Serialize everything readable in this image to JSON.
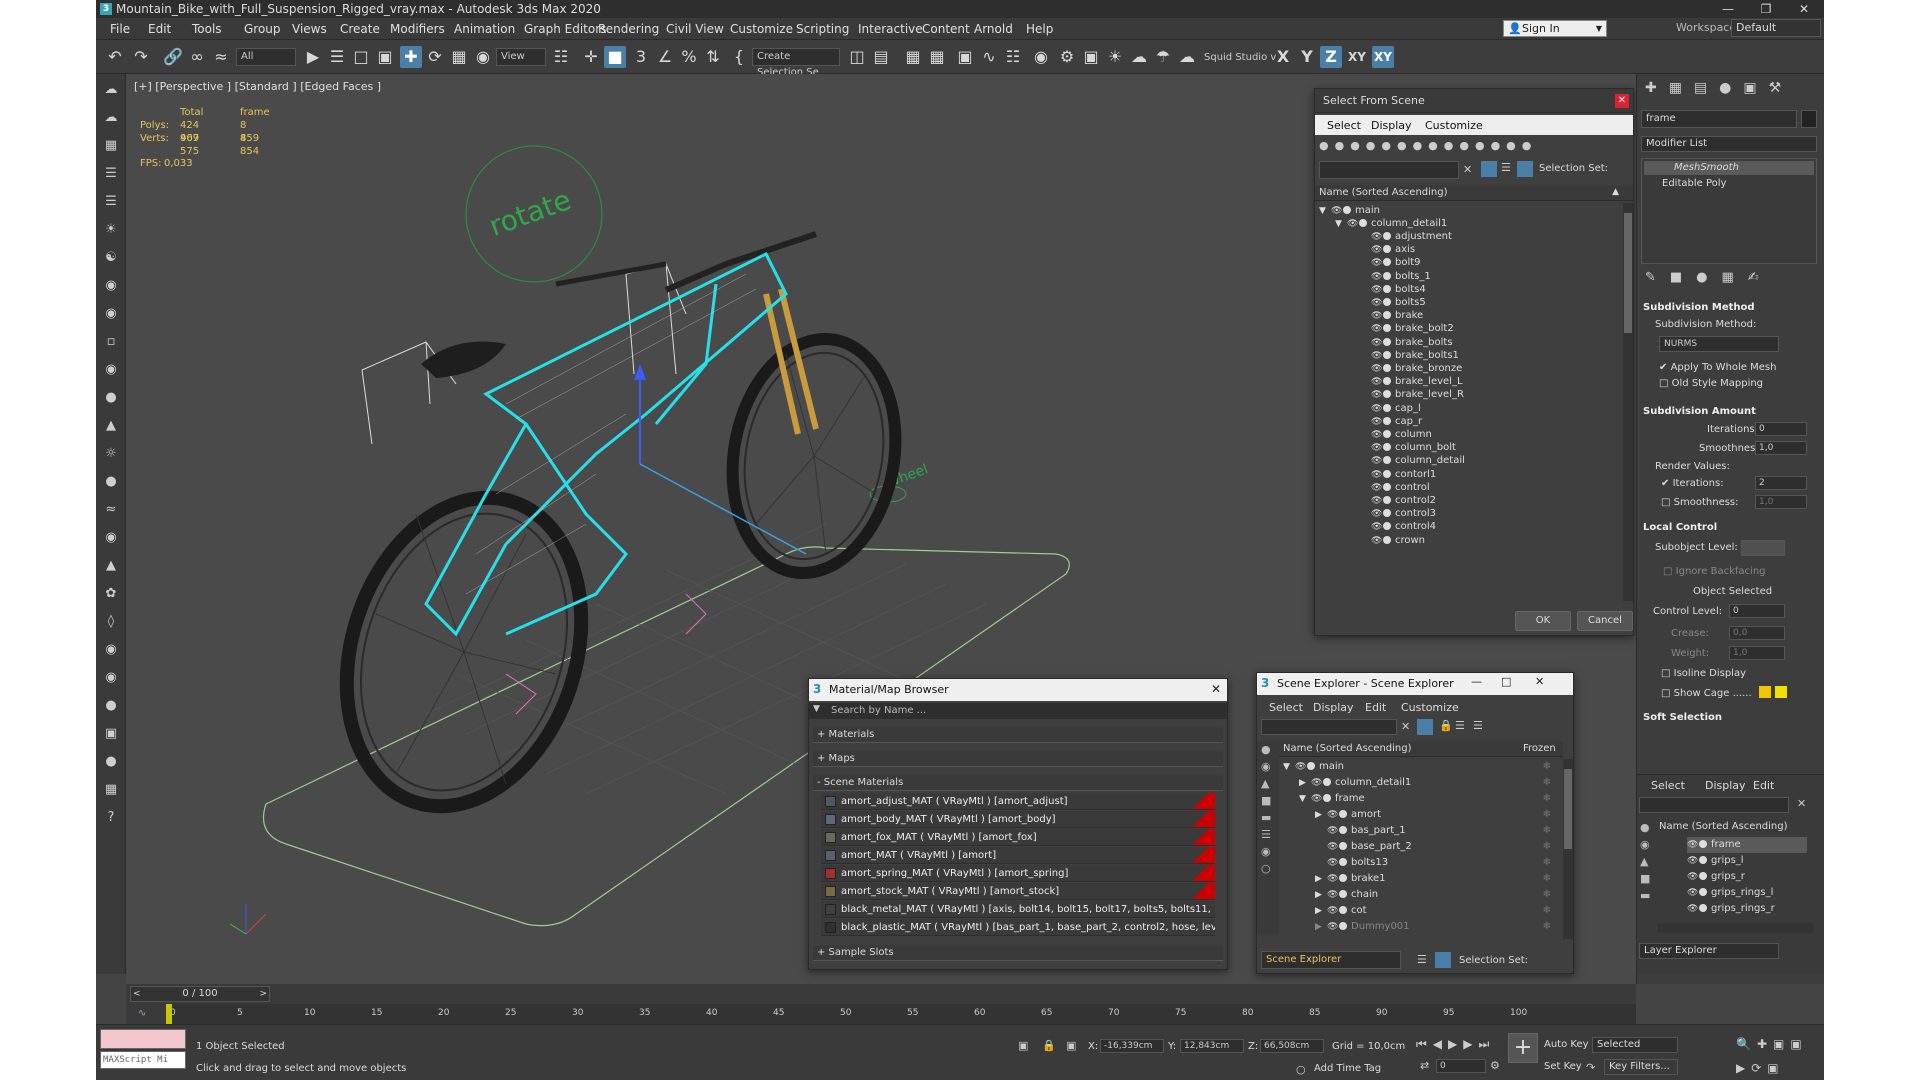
{
  "title": "Mountain_Bike_with_Full_Suspension_Rigged_vray.max - Autodesk 3ds Max 2020",
  "menu": [
    "File",
    "Edit",
    "Tools",
    "Group",
    "Views",
    "Create",
    "Modifiers",
    "Animation",
    "Graph Editors",
    "Rendering",
    "Civil View",
    "Customize",
    "Scripting",
    "Interactive",
    "Content",
    "Arnold",
    "Help"
  ],
  "signin": "Sign In",
  "workspaces_label": "Workspaces:",
  "workspaces_value": "Default",
  "toolbar": {
    "filter": "All",
    "refcoord": "View",
    "selset": "Create Selection Se",
    "squid": "Squid Studio v",
    "axes": [
      "X",
      "Y",
      "Z",
      "XY",
      "XY"
    ]
  },
  "viewport": {
    "label": "[+] [Perspective ] [Standard ] [Edged Faces ]",
    "stats": {
      "total_label": "Total",
      "frame_label": "frame",
      "polys_label": "Polys:",
      "polys_total": "424 969",
      "polys_frame": "8 459",
      "verts_label": "Verts:",
      "verts_total": "407 575",
      "verts_frame": "8 854",
      "fps_label": "FPS:",
      "fps_value": "0,033"
    },
    "rotate_text": "rotate",
    "wheel_text": "wheel"
  },
  "select_from_scene": {
    "title": "Select From Scene",
    "menu": [
      "Select",
      "Display",
      "Customize"
    ],
    "selection_set_label": "Selection Set:",
    "column_header": "Name (Sorted Ascending)",
    "root": "main",
    "group": "column_detail1",
    "items": [
      "adjustment",
      "axis",
      "bolt9",
      "bolts_1",
      "bolts4",
      "bolts5",
      "brake",
      "brake_bolt2",
      "brake_bolts",
      "brake_bolts1",
      "brake_bronze",
      "brake_level_L",
      "brake_level_R",
      "cap_l",
      "cap_r",
      "column",
      "column_bolt",
      "column_detail",
      "contorl1",
      "control",
      "control2",
      "control3",
      "control4",
      "crown"
    ],
    "ok": "OK",
    "cancel": "Cancel"
  },
  "material_browser": {
    "title": "Material/Map Browser",
    "search_placeholder": "Search by Name ...",
    "sections": [
      "+ Materials",
      "+ Maps",
      "- Scene Materials"
    ],
    "materials": [
      "amort_adjust_MAT ( VRayMtl ) [amort_adjust]",
      "amort_body_MAT ( VRayMtl ) [amort_body]",
      "amort_fox_MAT ( VRayMtl ) [amort_fox]",
      "amort_MAT ( VRayMtl ) [amort]",
      "amort_spring_MAT ( VRayMtl ) [amort_spring]",
      "amort_stock_MAT ( VRayMtl ) [amort_stock]",
      "black_metal_MAT ( VRayMtl ) [axis, bolt14, bolt15, bolt17, bolts5, bolts11, b...",
      "black_plastic_MAT ( VRayMtl ) [bas_part_1, base_part_2, control2, hose, lev..."
    ],
    "sample_slots": "+ Sample Slots"
  },
  "scene_explorer": {
    "title": "Scene Explorer - Scene Explorer",
    "menu": [
      "Select",
      "Display",
      "Edit",
      "Customize"
    ],
    "column_header": "Name (Sorted Ascending)",
    "frozen_header": "Frozen",
    "rows": [
      {
        "name": "main",
        "indent": 0,
        "expand": "▼"
      },
      {
        "name": "column_detail1",
        "indent": 1,
        "expand": "▶"
      },
      {
        "name": "frame",
        "indent": 1,
        "expand": "▼"
      },
      {
        "name": "amort",
        "indent": 2,
        "expand": "▶"
      },
      {
        "name": "bas_part_1",
        "indent": 2,
        "expand": ""
      },
      {
        "name": "base_part_2",
        "indent": 2,
        "expand": ""
      },
      {
        "name": "bolts13",
        "indent": 2,
        "expand": ""
      },
      {
        "name": "brake1",
        "indent": 2,
        "expand": "▶"
      },
      {
        "name": "chain",
        "indent": 2,
        "expand": "▶"
      },
      {
        "name": "cot",
        "indent": 2,
        "expand": "▶"
      },
      {
        "name": "Dummy001",
        "indent": 2,
        "expand": "▶"
      }
    ],
    "footer_dropdown": "Scene Explorer",
    "selection_set_label": "Selection Set:"
  },
  "command_panel": {
    "name_field": "frame",
    "modifier_list": "Modifier List",
    "stack": [
      "MeshSmooth",
      "Editable Poly"
    ],
    "subdivision_method_head": "Subdivision Method",
    "subdivision_method_label": "Subdivision Method:",
    "subdivision_method_value": "NURMS",
    "apply_whole_mesh": "Apply To Whole Mesh",
    "old_style_mapping": "Old Style Mapping",
    "subdivision_amount_head": "Subdivision Amount",
    "iterations_label": "Iterations:",
    "iterations_value": "0",
    "smoothness_label": "Smoothness:",
    "smoothness_value": "1,0",
    "render_values_label": "Render Values:",
    "render_iterations_value": "2",
    "render_smoothness_value": "1,0",
    "local_control_head": "Local Control",
    "subobject_level_label": "Subobject Level:",
    "ignore_backfacing": "Ignore Backfacing",
    "object_selected": "Object Selected",
    "control_level_label": "Control Level:",
    "control_level_value": "0",
    "crease_label": "Crease:",
    "crease_value": "0,0",
    "weight_label": "Weight:",
    "weight_value": "1,0",
    "isoline_display": "Isoline Display",
    "show_cage": "Show Cage ......",
    "soft_selection_head": "Soft Selection",
    "layer_menu": [
      "Select",
      "Display",
      "Edit"
    ],
    "layer_column_header": "Name (Sorted Ascending)",
    "layer_rows": [
      "frame",
      "grips_l",
      "grips_r",
      "grips_rings_l",
      "grips_rings_r"
    ],
    "layer_explorer": "Layer Explorer"
  },
  "timeline": {
    "frame_counter": "0 / 100",
    "ticks": [
      "0",
      "5",
      "10",
      "15",
      "20",
      "25",
      "30",
      "35",
      "40",
      "45",
      "50",
      "55",
      "60",
      "65",
      "70",
      "75",
      "80",
      "85",
      "90",
      "95",
      "100"
    ]
  },
  "status": {
    "maxscript": "MAXScript Mi",
    "selected": "1 Object Selected",
    "hint": "Click and drag to select and move objects",
    "x_label": "X:",
    "x_value": "-16,339cm",
    "y_label": "Y:",
    "y_value": "12,843cm",
    "z_label": "Z:",
    "z_value": "66,508cm",
    "grid": "Grid = 10,0cm",
    "add_time_tag": "Add Time Tag",
    "auto_key": "Auto Key",
    "selected_dropdown": "Selected",
    "set_key": "Set Key",
    "key_filters": "Key Filters...",
    "frame_field": "0"
  }
}
